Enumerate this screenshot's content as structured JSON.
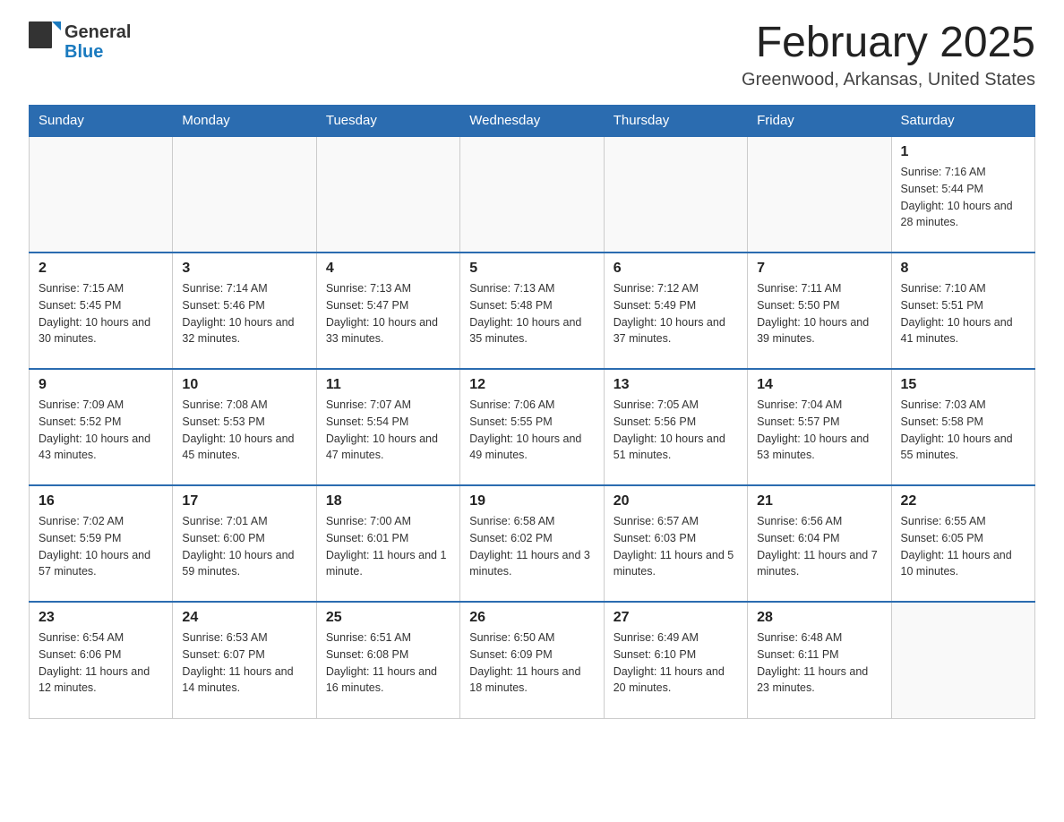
{
  "header": {
    "logo": {
      "general": "General",
      "blue": "Blue"
    },
    "title": "February 2025",
    "location": "Greenwood, Arkansas, United States"
  },
  "calendar": {
    "days_of_week": [
      "Sunday",
      "Monday",
      "Tuesday",
      "Wednesday",
      "Thursday",
      "Friday",
      "Saturday"
    ],
    "weeks": [
      [
        {
          "day": "",
          "info": ""
        },
        {
          "day": "",
          "info": ""
        },
        {
          "day": "",
          "info": ""
        },
        {
          "day": "",
          "info": ""
        },
        {
          "day": "",
          "info": ""
        },
        {
          "day": "",
          "info": ""
        },
        {
          "day": "1",
          "info": "Sunrise: 7:16 AM\nSunset: 5:44 PM\nDaylight: 10 hours and 28 minutes."
        }
      ],
      [
        {
          "day": "2",
          "info": "Sunrise: 7:15 AM\nSunset: 5:45 PM\nDaylight: 10 hours and 30 minutes."
        },
        {
          "day": "3",
          "info": "Sunrise: 7:14 AM\nSunset: 5:46 PM\nDaylight: 10 hours and 32 minutes."
        },
        {
          "day": "4",
          "info": "Sunrise: 7:13 AM\nSunset: 5:47 PM\nDaylight: 10 hours and 33 minutes."
        },
        {
          "day": "5",
          "info": "Sunrise: 7:13 AM\nSunset: 5:48 PM\nDaylight: 10 hours and 35 minutes."
        },
        {
          "day": "6",
          "info": "Sunrise: 7:12 AM\nSunset: 5:49 PM\nDaylight: 10 hours and 37 minutes."
        },
        {
          "day": "7",
          "info": "Sunrise: 7:11 AM\nSunset: 5:50 PM\nDaylight: 10 hours and 39 minutes."
        },
        {
          "day": "8",
          "info": "Sunrise: 7:10 AM\nSunset: 5:51 PM\nDaylight: 10 hours and 41 minutes."
        }
      ],
      [
        {
          "day": "9",
          "info": "Sunrise: 7:09 AM\nSunset: 5:52 PM\nDaylight: 10 hours and 43 minutes."
        },
        {
          "day": "10",
          "info": "Sunrise: 7:08 AM\nSunset: 5:53 PM\nDaylight: 10 hours and 45 minutes."
        },
        {
          "day": "11",
          "info": "Sunrise: 7:07 AM\nSunset: 5:54 PM\nDaylight: 10 hours and 47 minutes."
        },
        {
          "day": "12",
          "info": "Sunrise: 7:06 AM\nSunset: 5:55 PM\nDaylight: 10 hours and 49 minutes."
        },
        {
          "day": "13",
          "info": "Sunrise: 7:05 AM\nSunset: 5:56 PM\nDaylight: 10 hours and 51 minutes."
        },
        {
          "day": "14",
          "info": "Sunrise: 7:04 AM\nSunset: 5:57 PM\nDaylight: 10 hours and 53 minutes."
        },
        {
          "day": "15",
          "info": "Sunrise: 7:03 AM\nSunset: 5:58 PM\nDaylight: 10 hours and 55 minutes."
        }
      ],
      [
        {
          "day": "16",
          "info": "Sunrise: 7:02 AM\nSunset: 5:59 PM\nDaylight: 10 hours and 57 minutes."
        },
        {
          "day": "17",
          "info": "Sunrise: 7:01 AM\nSunset: 6:00 PM\nDaylight: 10 hours and 59 minutes."
        },
        {
          "day": "18",
          "info": "Sunrise: 7:00 AM\nSunset: 6:01 PM\nDaylight: 11 hours and 1 minute."
        },
        {
          "day": "19",
          "info": "Sunrise: 6:58 AM\nSunset: 6:02 PM\nDaylight: 11 hours and 3 minutes."
        },
        {
          "day": "20",
          "info": "Sunrise: 6:57 AM\nSunset: 6:03 PM\nDaylight: 11 hours and 5 minutes."
        },
        {
          "day": "21",
          "info": "Sunrise: 6:56 AM\nSunset: 6:04 PM\nDaylight: 11 hours and 7 minutes."
        },
        {
          "day": "22",
          "info": "Sunrise: 6:55 AM\nSunset: 6:05 PM\nDaylight: 11 hours and 10 minutes."
        }
      ],
      [
        {
          "day": "23",
          "info": "Sunrise: 6:54 AM\nSunset: 6:06 PM\nDaylight: 11 hours and 12 minutes."
        },
        {
          "day": "24",
          "info": "Sunrise: 6:53 AM\nSunset: 6:07 PM\nDaylight: 11 hours and 14 minutes."
        },
        {
          "day": "25",
          "info": "Sunrise: 6:51 AM\nSunset: 6:08 PM\nDaylight: 11 hours and 16 minutes."
        },
        {
          "day": "26",
          "info": "Sunrise: 6:50 AM\nSunset: 6:09 PM\nDaylight: 11 hours and 18 minutes."
        },
        {
          "day": "27",
          "info": "Sunrise: 6:49 AM\nSunset: 6:10 PM\nDaylight: 11 hours and 20 minutes."
        },
        {
          "day": "28",
          "info": "Sunrise: 6:48 AM\nSunset: 6:11 PM\nDaylight: 11 hours and 23 minutes."
        },
        {
          "day": "",
          "info": ""
        }
      ]
    ]
  }
}
